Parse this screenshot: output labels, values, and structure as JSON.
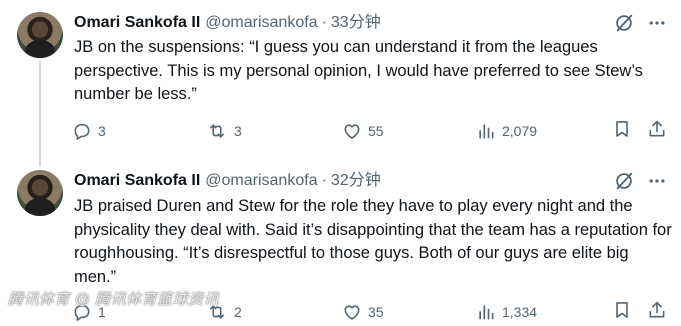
{
  "tweets": [
    {
      "display_name": "Omari Sankofa II",
      "handle": "@omarisankofa",
      "separator": "·",
      "time": "33分钟",
      "text": "JB on the suspensions: “I guess you can understand it from the leagues perspective. This is my personal opinion, I would have preferred to see Stew’s number be less.”",
      "replies": "3",
      "reposts": "3",
      "likes": "55",
      "views": "2,079"
    },
    {
      "display_name": "Omari Sankofa II",
      "handle": "@omarisankofa",
      "separator": "·",
      "time": "32分钟",
      "text": "JB praised Duren and Stew for the role they have to play every night and the physicality they deal with. Said it’s disappointing that the team has a reputation for roughhousing. “It’s disrespectful to those guys. Both of our guys are elite big men.”",
      "replies": "1",
      "reposts": "2",
      "likes": "35",
      "views": "1,334"
    }
  ],
  "watermark": "腾讯体育 @ 腾讯体育篮球资讯",
  "colors": {
    "text": "#0f1419",
    "secondary": "#536471",
    "thread_line": "#cfd9de",
    "background": "#ffffff"
  },
  "icons": [
    "grok-icon",
    "more-icon",
    "reply-icon",
    "repost-icon",
    "like-icon",
    "views-icon",
    "bookmark-icon",
    "share-icon"
  ]
}
